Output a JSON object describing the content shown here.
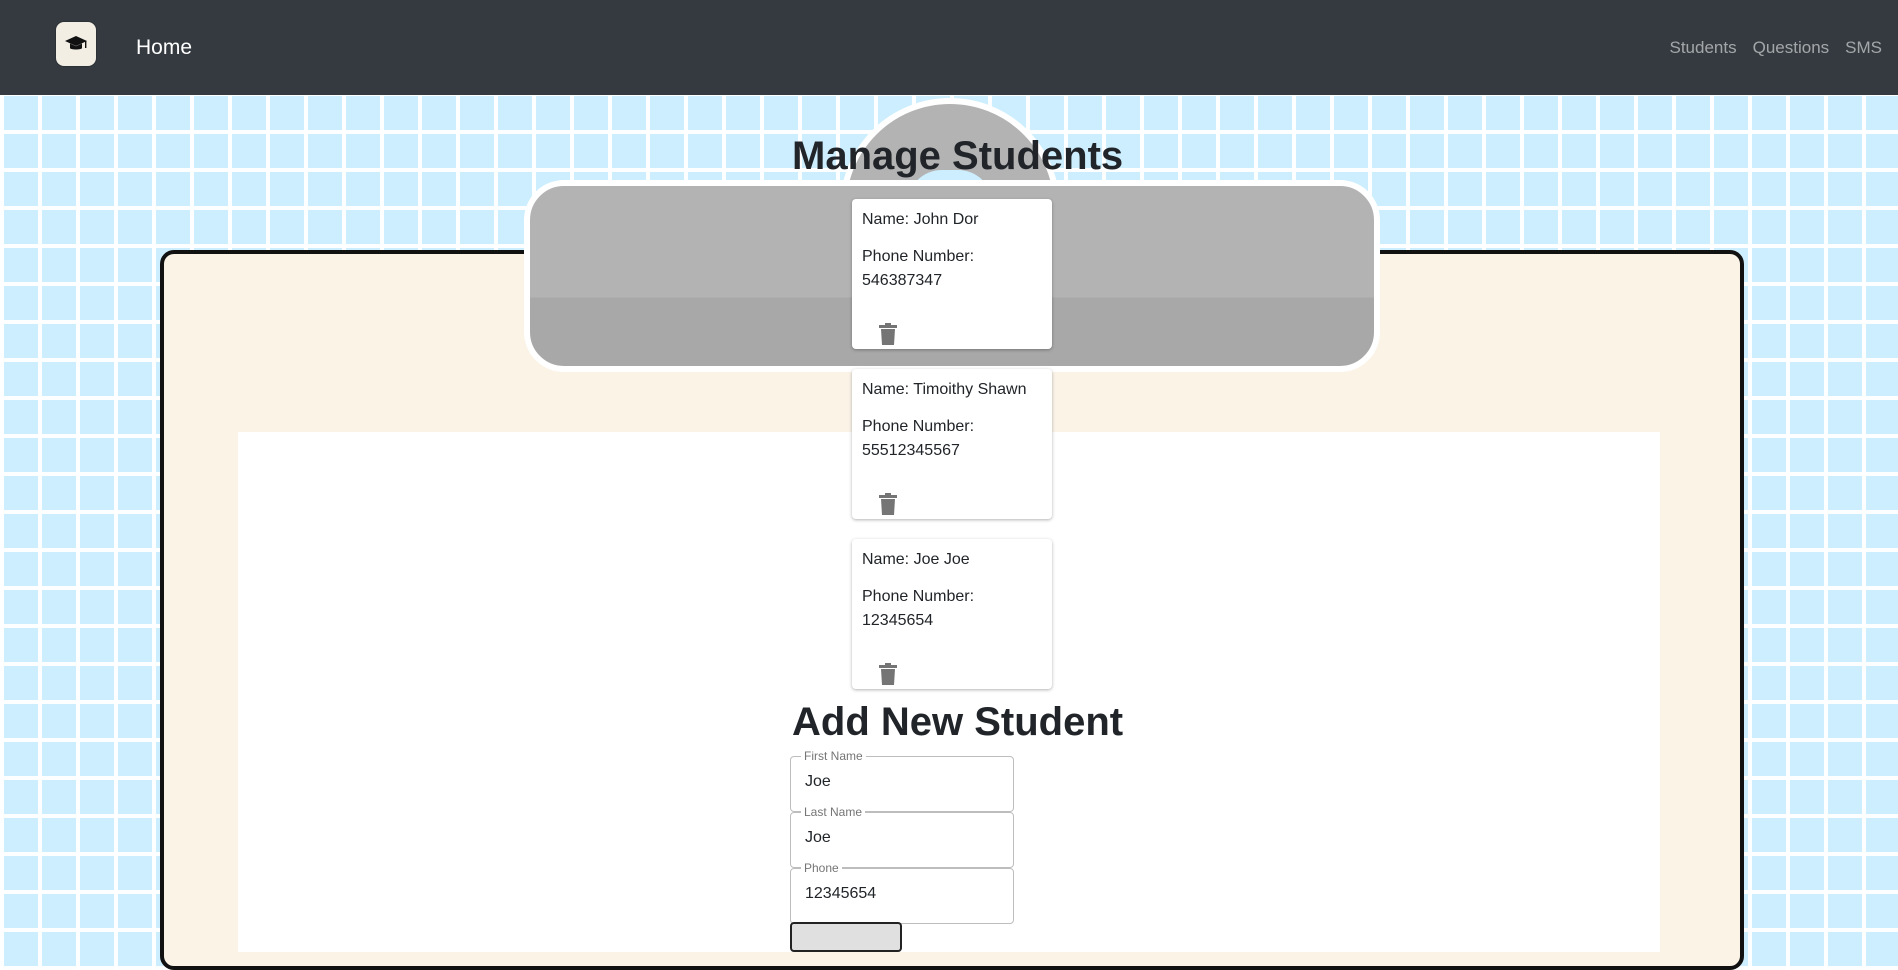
{
  "navbar": {
    "home_label": "Home",
    "links": [
      "Students",
      "Questions",
      "SMS"
    ],
    "logo_icon": "graduation-cap-icon"
  },
  "page": {
    "title": "Manage Students",
    "add_title": "Add New Student"
  },
  "students": [
    {
      "name": "Name: John Dor",
      "phone_label": "Phone Number:",
      "phone": "546387347"
    },
    {
      "name": "Name: Timoithy Shawn",
      "phone_label": "Phone Number:",
      "phone": "55512345567"
    },
    {
      "name": "Name: Joe Joe",
      "phone_label": "Phone Number:",
      "phone": "12345654"
    }
  ],
  "form": {
    "first_name": {
      "label": "First Name",
      "value": "Joe"
    },
    "last_name": {
      "label": "Last Name",
      "value": "Joe"
    },
    "phone": {
      "label": "Phone",
      "value": "12345654"
    }
  },
  "colors": {
    "navbar": "#343a40",
    "background": "#cdeefe",
    "board": "#faf3e6",
    "clip": "#b3b3b3"
  }
}
